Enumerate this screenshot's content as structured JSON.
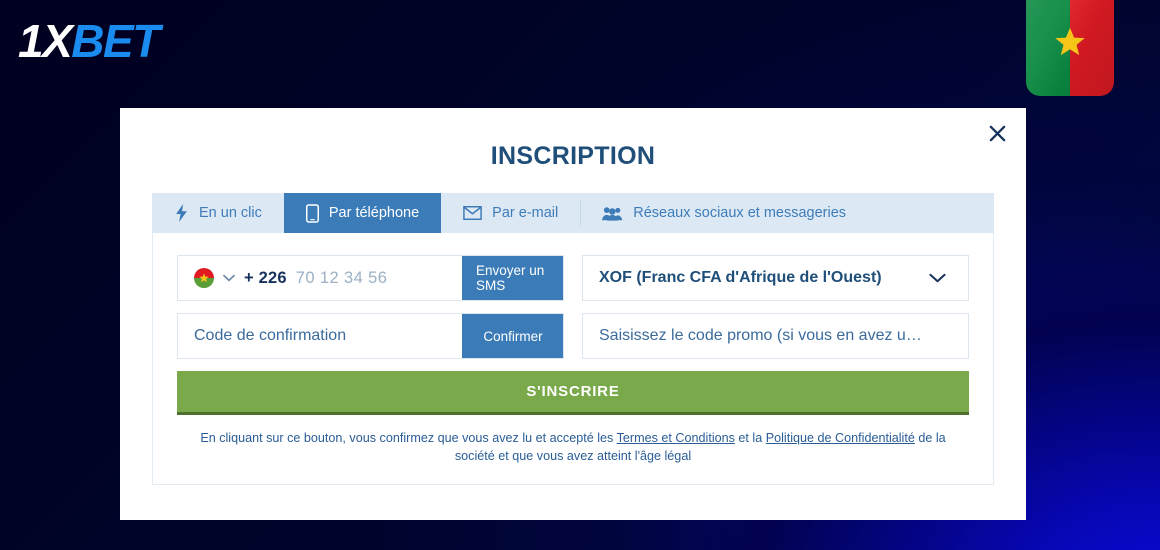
{
  "brand": {
    "logo_one_x": "1X",
    "logo_bet": "BET"
  },
  "decor": {
    "flag_icon": "burkina-faso-flag",
    "flag_colors": {
      "green": "#0b8a42",
      "red": "#e01b24",
      "star": "#f5c518"
    }
  },
  "modal": {
    "title": "INSCRIPTION",
    "close_label": "✕",
    "close_icon": "close-icon"
  },
  "tabs": [
    {
      "label": "En un clic",
      "icon": "lightning-bolt-icon",
      "active": false
    },
    {
      "label": "Par téléphone",
      "icon": "mobile-phone-icon",
      "active": true
    },
    {
      "label": "Par e-mail",
      "icon": "envelope-icon",
      "active": false
    },
    {
      "label": "Réseaux sociaux et messageries",
      "icon": "people-group-icon",
      "active": false
    }
  ],
  "form": {
    "phone": {
      "flag_icon": "burkina-faso-circle-flag",
      "chevron_icon": "chevron-down-icon",
      "dial_code": "+ 226",
      "placeholder": "70 12 34 56",
      "value": "",
      "send_sms_label": "Envoyer un SMS"
    },
    "currency": {
      "value": "XOF (Franc CFA d'Afrique de l'Ouest)",
      "chevron_icon": "chevron-down-icon"
    },
    "confirmation": {
      "placeholder": "Code de confirmation",
      "value": "",
      "confirm_label": "Confirmer"
    },
    "promo": {
      "placeholder": "Saisissez le code promo (si vous en avez u…",
      "value": ""
    },
    "submit_label": "S'INSCRIRE"
  },
  "terms": {
    "part1": "En cliquant sur ce bouton, vous confirmez que vous avez lu et accepté les ",
    "link1": "Termes et Conditions",
    "part2": " et la ",
    "link2": "Politique de Confidentialité",
    "part3": " de la société et que vous avez atteint l'âge légal"
  },
  "colors": {
    "accent_blue": "#3b7cb8",
    "title_blue": "#1f4e79",
    "submit_green": "#79a94b",
    "tabbar_bg": "#dce9f5"
  }
}
